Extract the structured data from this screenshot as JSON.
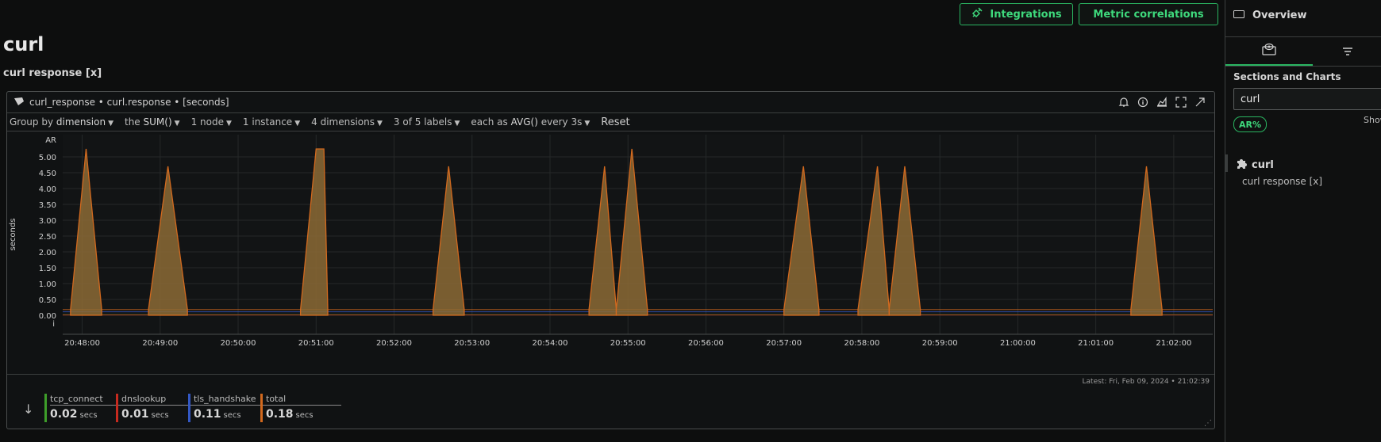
{
  "header": {
    "integrations_label": "Integrations",
    "metric_correlations_label": "Metric correlations",
    "page_title": "curl",
    "section_title": "curl response [x]"
  },
  "chart_panel": {
    "title": "curl_response • curl.response • [seconds]",
    "toolbar": {
      "group_by_prefix": "Group by",
      "group_by_value": "dimension",
      "agg_prefix": "the",
      "agg_value": "SUM()",
      "nodes": "1 node",
      "instances": "1 instance",
      "dimensions": "4 dimensions",
      "labels": "3 of 5 labels",
      "each_as_prefix": "each as",
      "each_as_value": "AVG()",
      "every": "every 3s",
      "reset_label": "Reset"
    },
    "latest": "Latest:  Fri, Feb 09, 2024 • 21:02:39",
    "legend": [
      {
        "name": "tcp_connect",
        "value": "0.02",
        "unit": "secs",
        "color": "#3e9e2a"
      },
      {
        "name": "dnslookup",
        "value": "0.01",
        "unit": "secs",
        "color": "#c62a1f"
      },
      {
        "name": "tls_handshake",
        "value": "0.11",
        "unit": "secs",
        "color": "#3358c4"
      },
      {
        "name": "total",
        "value": "0.18",
        "unit": "secs",
        "color": "#d2691e"
      }
    ]
  },
  "chart_data": {
    "type": "area",
    "ylabel": "seconds",
    "y_top_label": "AR",
    "y_bottom_label": "i",
    "ylim": [
      -0.6,
      5.7
    ],
    "yticks": [
      0.0,
      0.5,
      1.0,
      1.5,
      2.0,
      2.5,
      3.0,
      3.5,
      4.0,
      4.5,
      5.0
    ],
    "ytick_labels": [
      "0.00",
      "0.50",
      "1.00",
      "1.50",
      "2.00",
      "2.50",
      "3.00",
      "3.50",
      "4.00",
      "4.50",
      "5.00"
    ],
    "xlim": [
      "20:47:45",
      "21:02:30"
    ],
    "xticks": [
      "20:48:00",
      "20:49:00",
      "20:50:00",
      "20:51:00",
      "20:52:00",
      "20:53:00",
      "20:54:00",
      "20:55:00",
      "20:56:00",
      "20:57:00",
      "20:58:00",
      "20:59:00",
      "21:00:00",
      "21:01:00",
      "21:02:00"
    ],
    "baseline_series": [
      {
        "name": "tcp_connect",
        "color": "#3e9e2a",
        "level": 0.02
      },
      {
        "name": "dnslookup",
        "color": "#c62a1f",
        "level": 0.01
      },
      {
        "name": "tls_handshake",
        "color": "#3358c4",
        "level": 0.11
      },
      {
        "name": "total",
        "color": "#d2691e",
        "level": 0.18
      }
    ],
    "spikes": [
      {
        "start": "20:47:51",
        "peak": "20:48:03",
        "end": "20:48:15",
        "value": 5.25
      },
      {
        "start": "20:48:51",
        "peak": "20:49:06",
        "end": "20:49:21",
        "value": 4.7
      },
      {
        "start": "20:50:48",
        "peak": "20:51:00",
        "end": "20:51:09",
        "peak_end": "20:51:06",
        "value": 5.25
      },
      {
        "start": "20:52:30",
        "peak": "20:52:42",
        "end": "20:52:54",
        "value": 4.7
      },
      {
        "start": "20:54:30",
        "peak": "20:54:42",
        "end": "20:54:51",
        "value": 4.7
      },
      {
        "start": "20:54:51",
        "peak": "20:55:03",
        "end": "20:55:15",
        "value": 5.25
      },
      {
        "start": "20:57:00",
        "peak": "20:57:15",
        "end": "20:57:27",
        "value": 4.7
      },
      {
        "start": "20:57:57",
        "peak": "20:58:12",
        "end": "20:58:21",
        "value": 4.7
      },
      {
        "start": "20:58:21",
        "peak": "20:58:33",
        "end": "20:58:45",
        "value": 4.7
      },
      {
        "start": "21:01:27",
        "peak": "21:01:39",
        "end": "21:01:51",
        "value": 4.7
      }
    ]
  },
  "right_panel": {
    "overview_label": "Overview",
    "sections_label": "Sections and Charts",
    "search_value": "curl",
    "badge_label": "AR%",
    "show_label": "Show",
    "section_name": "curl",
    "section_item": "curl response [x]"
  }
}
